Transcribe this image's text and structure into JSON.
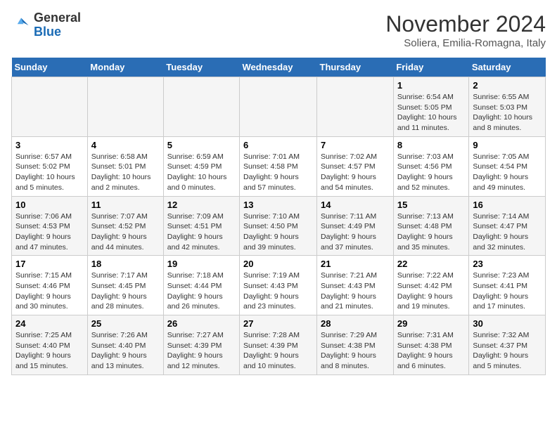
{
  "logo": {
    "general": "General",
    "blue": "Blue"
  },
  "title": {
    "month": "November 2024",
    "location": "Soliera, Emilia-Romagna, Italy"
  },
  "weekdays": [
    "Sunday",
    "Monday",
    "Tuesday",
    "Wednesday",
    "Thursday",
    "Friday",
    "Saturday"
  ],
  "weeks": [
    [
      {
        "day": "",
        "info": ""
      },
      {
        "day": "",
        "info": ""
      },
      {
        "day": "",
        "info": ""
      },
      {
        "day": "",
        "info": ""
      },
      {
        "day": "",
        "info": ""
      },
      {
        "day": "1",
        "info": "Sunrise: 6:54 AM\nSunset: 5:05 PM\nDaylight: 10 hours and 11 minutes."
      },
      {
        "day": "2",
        "info": "Sunrise: 6:55 AM\nSunset: 5:03 PM\nDaylight: 10 hours and 8 minutes."
      }
    ],
    [
      {
        "day": "3",
        "info": "Sunrise: 6:57 AM\nSunset: 5:02 PM\nDaylight: 10 hours and 5 minutes."
      },
      {
        "day": "4",
        "info": "Sunrise: 6:58 AM\nSunset: 5:01 PM\nDaylight: 10 hours and 2 minutes."
      },
      {
        "day": "5",
        "info": "Sunrise: 6:59 AM\nSunset: 4:59 PM\nDaylight: 10 hours and 0 minutes."
      },
      {
        "day": "6",
        "info": "Sunrise: 7:01 AM\nSunset: 4:58 PM\nDaylight: 9 hours and 57 minutes."
      },
      {
        "day": "7",
        "info": "Sunrise: 7:02 AM\nSunset: 4:57 PM\nDaylight: 9 hours and 54 minutes."
      },
      {
        "day": "8",
        "info": "Sunrise: 7:03 AM\nSunset: 4:56 PM\nDaylight: 9 hours and 52 minutes."
      },
      {
        "day": "9",
        "info": "Sunrise: 7:05 AM\nSunset: 4:54 PM\nDaylight: 9 hours and 49 minutes."
      }
    ],
    [
      {
        "day": "10",
        "info": "Sunrise: 7:06 AM\nSunset: 4:53 PM\nDaylight: 9 hours and 47 minutes."
      },
      {
        "day": "11",
        "info": "Sunrise: 7:07 AM\nSunset: 4:52 PM\nDaylight: 9 hours and 44 minutes."
      },
      {
        "day": "12",
        "info": "Sunrise: 7:09 AM\nSunset: 4:51 PM\nDaylight: 9 hours and 42 minutes."
      },
      {
        "day": "13",
        "info": "Sunrise: 7:10 AM\nSunset: 4:50 PM\nDaylight: 9 hours and 39 minutes."
      },
      {
        "day": "14",
        "info": "Sunrise: 7:11 AM\nSunset: 4:49 PM\nDaylight: 9 hours and 37 minutes."
      },
      {
        "day": "15",
        "info": "Sunrise: 7:13 AM\nSunset: 4:48 PM\nDaylight: 9 hours and 35 minutes."
      },
      {
        "day": "16",
        "info": "Sunrise: 7:14 AM\nSunset: 4:47 PM\nDaylight: 9 hours and 32 minutes."
      }
    ],
    [
      {
        "day": "17",
        "info": "Sunrise: 7:15 AM\nSunset: 4:46 PM\nDaylight: 9 hours and 30 minutes."
      },
      {
        "day": "18",
        "info": "Sunrise: 7:17 AM\nSunset: 4:45 PM\nDaylight: 9 hours and 28 minutes."
      },
      {
        "day": "19",
        "info": "Sunrise: 7:18 AM\nSunset: 4:44 PM\nDaylight: 9 hours and 26 minutes."
      },
      {
        "day": "20",
        "info": "Sunrise: 7:19 AM\nSunset: 4:43 PM\nDaylight: 9 hours and 23 minutes."
      },
      {
        "day": "21",
        "info": "Sunrise: 7:21 AM\nSunset: 4:43 PM\nDaylight: 9 hours and 21 minutes."
      },
      {
        "day": "22",
        "info": "Sunrise: 7:22 AM\nSunset: 4:42 PM\nDaylight: 9 hours and 19 minutes."
      },
      {
        "day": "23",
        "info": "Sunrise: 7:23 AM\nSunset: 4:41 PM\nDaylight: 9 hours and 17 minutes."
      }
    ],
    [
      {
        "day": "24",
        "info": "Sunrise: 7:25 AM\nSunset: 4:40 PM\nDaylight: 9 hours and 15 minutes."
      },
      {
        "day": "25",
        "info": "Sunrise: 7:26 AM\nSunset: 4:40 PM\nDaylight: 9 hours and 13 minutes."
      },
      {
        "day": "26",
        "info": "Sunrise: 7:27 AM\nSunset: 4:39 PM\nDaylight: 9 hours and 12 minutes."
      },
      {
        "day": "27",
        "info": "Sunrise: 7:28 AM\nSunset: 4:39 PM\nDaylight: 9 hours and 10 minutes."
      },
      {
        "day": "28",
        "info": "Sunrise: 7:29 AM\nSunset: 4:38 PM\nDaylight: 9 hours and 8 minutes."
      },
      {
        "day": "29",
        "info": "Sunrise: 7:31 AM\nSunset: 4:38 PM\nDaylight: 9 hours and 6 minutes."
      },
      {
        "day": "30",
        "info": "Sunrise: 7:32 AM\nSunset: 4:37 PM\nDaylight: 9 hours and 5 minutes."
      }
    ]
  ]
}
